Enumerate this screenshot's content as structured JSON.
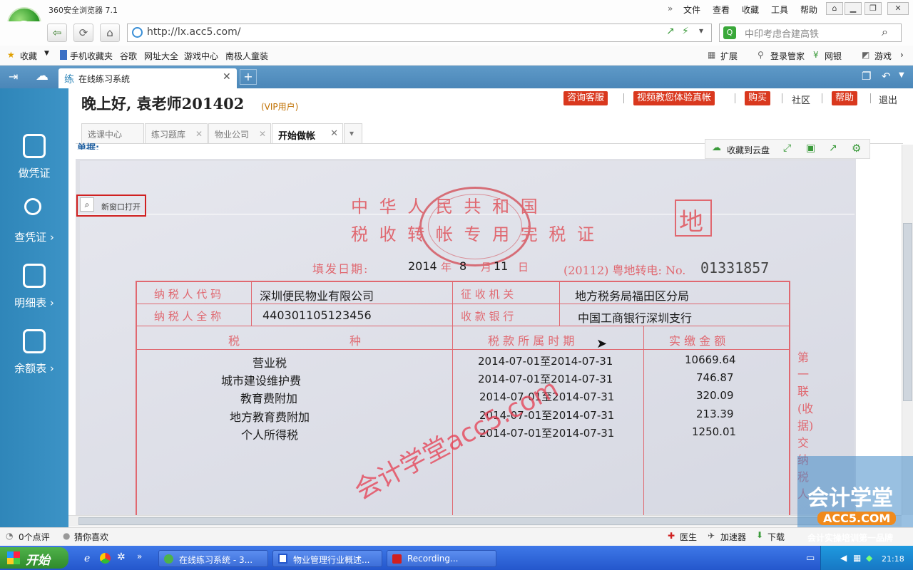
{
  "browser": {
    "app_title": "360安全浏览器 7.1",
    "menu": [
      "文件",
      "查看",
      "收藏",
      "工具",
      "帮助"
    ],
    "url": "http://lx.acc5.com/",
    "search_placeholder": "中印考虑合建高铁"
  },
  "bookmarks": {
    "left": [
      "收藏",
      "手机收藏夹",
      "谷歌",
      "网址大全",
      "游戏中心",
      "南极人童装"
    ],
    "right": [
      "扩展",
      "登录管家",
      "网银",
      "游戏"
    ]
  },
  "tab": {
    "label": "在线练习系统",
    "icon": "练"
  },
  "sidebar": [
    {
      "label": "做凭证",
      "icon": "calculator-icon"
    },
    {
      "label": "查凭证 ›",
      "icon": "search-icon"
    },
    {
      "label": "明细表 ›",
      "icon": "list-icon"
    },
    {
      "label": "余额表 ›",
      "icon": "table-icon"
    }
  ],
  "header": {
    "greeting": "晚上好, 袁老师201402",
    "vip": "(VIP用户)",
    "buttons": [
      "咨询客服",
      "视频教您体验真帐",
      "购买",
      "社区",
      "帮助",
      "退出"
    ]
  },
  "content_tabs": [
    "选课中心",
    "练习题库",
    "物业公司",
    "开始做帐"
  ],
  "toolbar": {
    "cloud_save": "收藏到云盘"
  },
  "section_label": "单据:",
  "open_new_window": "新窗口打开",
  "certificate": {
    "title_line1": "中 华 人 民 共 和 国",
    "title_line2": "税 收 转 帐 专 用 完 税 证",
    "di_mark": "地",
    "fill_date_label": "填发日期:",
    "year": "2014",
    "year_unit": "年",
    "month": "8",
    "month_unit": "月",
    "day": "11",
    "day_unit": "日",
    "serial_label": "(20112) 粤地转电: No.",
    "serial_number": "01331857",
    "taxpayer_code_label": "纳 税 人 代 码",
    "taxpayer_code_value": "深圳便民物业有限公司",
    "taxpayer_name_label": "纳 税 人 全 称",
    "taxpayer_name_value": "440301105123456",
    "collector_label": "征 收 机 关",
    "collector_value": "地方税务局福田区分局",
    "bank_label": "收 款 银 行",
    "bank_value": "中国工商银行深圳支行",
    "col_tax": "税",
    "col_item": "种",
    "col_period": "税 款 所 属 时 期",
    "col_amount": "实 缴 金 额",
    "side_note": "第一联 (收据) 交纳税人",
    "rows": [
      {
        "tax": "营业税",
        "period": "2014-07-01至2014-07-31",
        "amount": "10669.64"
      },
      {
        "tax": "城市建设维护费",
        "period": "2014-07-01至2014-07-31",
        "amount": "746.87"
      },
      {
        "tax": "教育费附加",
        "period": "2014-07-01至2014-07-31",
        "amount": "320.09"
      },
      {
        "tax": "地方教育费附加",
        "period": "2014-07-01至2014-07-31",
        "amount": "213.39"
      },
      {
        "tax": "个人所得税",
        "period": "2014-07-01至2014-07-31",
        "amount": "1250.01"
      }
    ],
    "watermark": "会计学堂acc5.com"
  },
  "statusbar": {
    "left": [
      "0个点评",
      "猜你喜欢"
    ],
    "right": [
      "医生",
      "加速器",
      "下载"
    ]
  },
  "brand_overlay": {
    "line1": "会计学堂",
    "line2": "ACC5.COM",
    "line3": "会计实操培训第一品牌"
  },
  "taskbar": {
    "start": "开始",
    "tasks": [
      "在线练习系统 - 3...",
      "物业管理行业概述...",
      "Recording..."
    ],
    "clock": "21:18"
  }
}
